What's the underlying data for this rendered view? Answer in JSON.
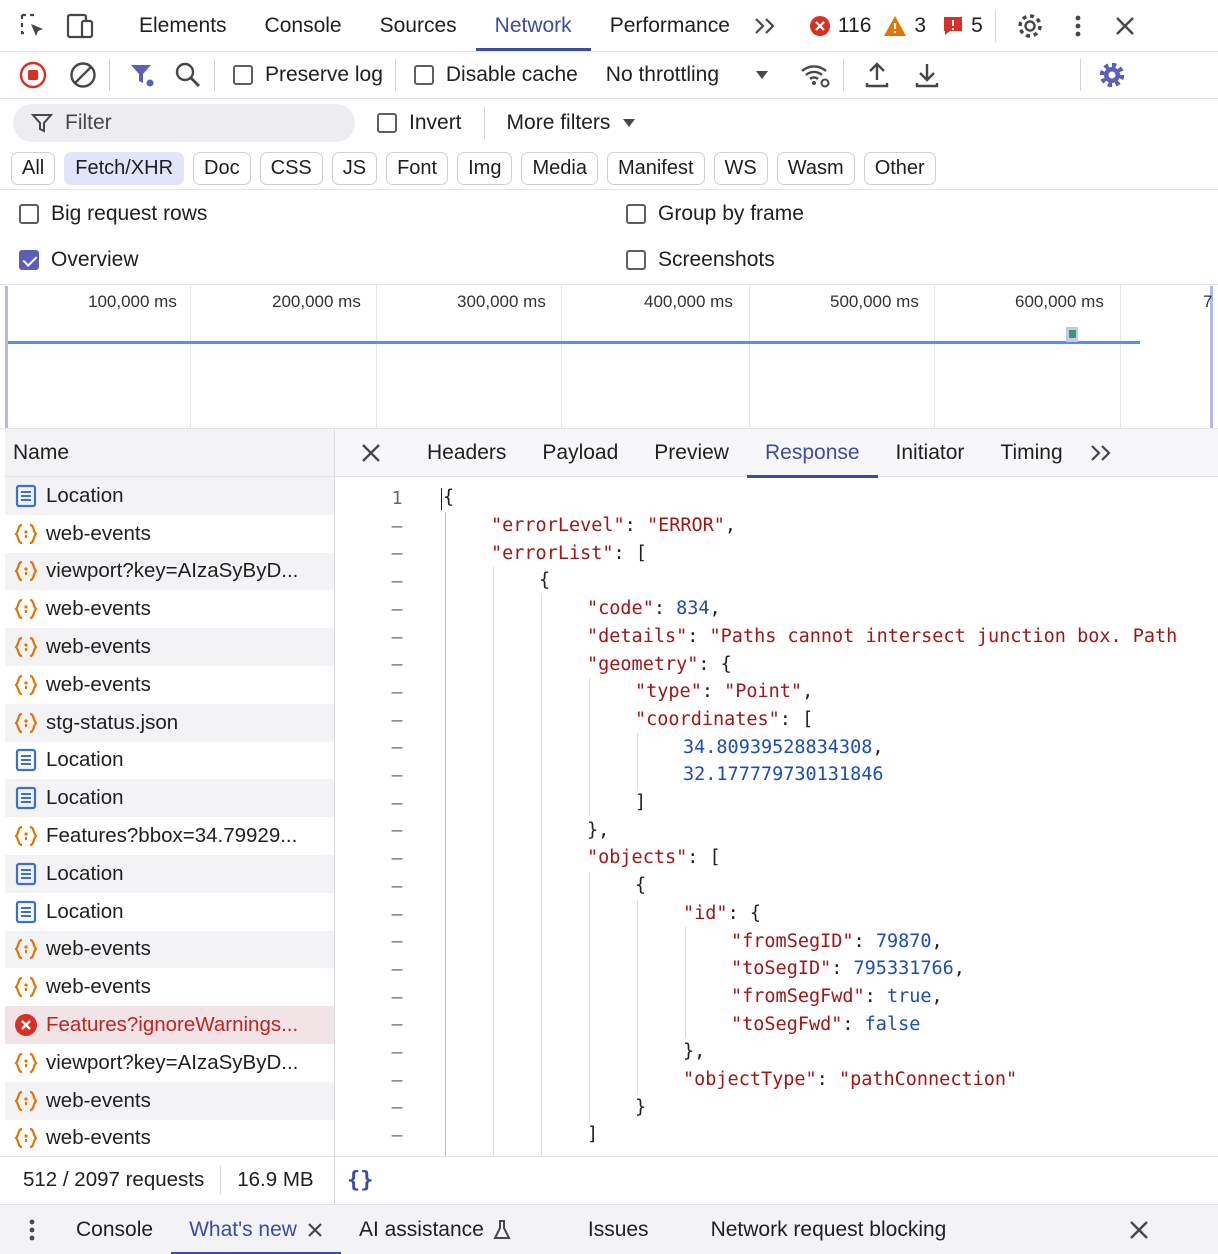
{
  "devtools": {
    "tabs": [
      "Elements",
      "Console",
      "Sources",
      "Network",
      "Performance"
    ],
    "active_tab": "Network",
    "error_count": "116",
    "warning_count": "3",
    "issue_count": "5"
  },
  "toolbar": {
    "preserve_log": "Preserve log",
    "disable_cache": "Disable cache",
    "throttling": "No throttling"
  },
  "filter_bar": {
    "placeholder": "Filter",
    "invert": "Invert",
    "more_filters": "More filters"
  },
  "type_filters": [
    "All",
    "Fetch/XHR",
    "Doc",
    "CSS",
    "JS",
    "Font",
    "Img",
    "Media",
    "Manifest",
    "WS",
    "Wasm",
    "Other"
  ],
  "active_type_filter": "Fetch/XHR",
  "options": {
    "big_request_rows": "Big request rows",
    "group_by_frame": "Group by frame",
    "overview": "Overview",
    "screenshots": "Screenshots"
  },
  "timeline": {
    "labels": [
      "100,000 ms",
      "200,000 ms",
      "300,000 ms",
      "400,000 ms",
      "500,000 ms",
      "600,000 ms",
      "7"
    ]
  },
  "request_list": {
    "header": "Name",
    "rows": [
      {
        "name": "Location",
        "icon": "document-icon"
      },
      {
        "name": "web-events",
        "icon": "fetch-icon"
      },
      {
        "name": "viewport?key=AIzaSyByD...",
        "icon": "fetch-icon"
      },
      {
        "name": "web-events",
        "icon": "fetch-icon"
      },
      {
        "name": "web-events",
        "icon": "fetch-icon"
      },
      {
        "name": "web-events",
        "icon": "fetch-icon"
      },
      {
        "name": "stg-status.json",
        "icon": "fetch-icon"
      },
      {
        "name": "Location",
        "icon": "document-icon"
      },
      {
        "name": "Location",
        "icon": "document-icon"
      },
      {
        "name": "Features?bbox=34.79929...",
        "icon": "fetch-icon"
      },
      {
        "name": "Location",
        "icon": "document-icon"
      },
      {
        "name": "Location",
        "icon": "document-icon"
      },
      {
        "name": "web-events",
        "icon": "fetch-icon"
      },
      {
        "name": "web-events",
        "icon": "fetch-icon"
      },
      {
        "name": "Features?ignoreWarnings...",
        "icon": "error-icon"
      },
      {
        "name": "viewport?key=AIzaSyByD...",
        "icon": "fetch-icon"
      },
      {
        "name": "web-events",
        "icon": "fetch-icon"
      },
      {
        "name": "web-events",
        "icon": "fetch-icon"
      }
    ],
    "summary_requests": "512 / 2097 requests",
    "summary_size": "16.9 MB"
  },
  "details": {
    "tabs": [
      "Headers",
      "Payload",
      "Preview",
      "Response",
      "Initiator",
      "Timing"
    ],
    "active_tab": "Response",
    "line_number": "1",
    "format_button": "{}"
  },
  "response_lines": [
    {
      "d": 0,
      "t": [
        [
          "p",
          "{"
        ]
      ]
    },
    {
      "d": 1,
      "t": [
        [
          "k",
          "\"errorLevel\""
        ],
        [
          "p",
          ": "
        ],
        [
          "s",
          "\"ERROR\""
        ],
        [
          "p",
          ","
        ]
      ]
    },
    {
      "d": 1,
      "t": [
        [
          "k",
          "\"errorList\""
        ],
        [
          "p",
          ": ["
        ]
      ]
    },
    {
      "d": 2,
      "t": [
        [
          "p",
          "{"
        ]
      ]
    },
    {
      "d": 3,
      "t": [
        [
          "k",
          "\"code\""
        ],
        [
          "p",
          ": "
        ],
        [
          "n",
          "834"
        ],
        [
          "p",
          ","
        ]
      ]
    },
    {
      "d": 3,
      "t": [
        [
          "k",
          "\"details\""
        ],
        [
          "p",
          ": "
        ],
        [
          "s",
          "\"Paths cannot intersect junction box. Path"
        ]
      ]
    },
    {
      "d": 3,
      "t": [
        [
          "k",
          "\"geometry\""
        ],
        [
          "p",
          ": {"
        ]
      ]
    },
    {
      "d": 4,
      "t": [
        [
          "k",
          "\"type\""
        ],
        [
          "p",
          ": "
        ],
        [
          "s",
          "\"Point\""
        ],
        [
          "p",
          ","
        ]
      ]
    },
    {
      "d": 4,
      "t": [
        [
          "k",
          "\"coordinates\""
        ],
        [
          "p",
          ": ["
        ]
      ]
    },
    {
      "d": 5,
      "t": [
        [
          "n",
          "34.80939528834308"
        ],
        [
          "p",
          ","
        ]
      ]
    },
    {
      "d": 5,
      "t": [
        [
          "n",
          "32.177779730131846"
        ]
      ]
    },
    {
      "d": 4,
      "t": [
        [
          "p",
          "]"
        ]
      ]
    },
    {
      "d": 3,
      "t": [
        [
          "p",
          "},"
        ]
      ]
    },
    {
      "d": 3,
      "t": [
        [
          "k",
          "\"objects\""
        ],
        [
          "p",
          ": ["
        ]
      ]
    },
    {
      "d": 4,
      "t": [
        [
          "p",
          "{"
        ]
      ]
    },
    {
      "d": 5,
      "t": [
        [
          "k",
          "\"id\""
        ],
        [
          "p",
          ": {"
        ]
      ]
    },
    {
      "d": 6,
      "t": [
        [
          "k",
          "\"fromSegID\""
        ],
        [
          "p",
          ": "
        ],
        [
          "n",
          "79870"
        ],
        [
          "p",
          ","
        ]
      ]
    },
    {
      "d": 6,
      "t": [
        [
          "k",
          "\"toSegID\""
        ],
        [
          "p",
          ": "
        ],
        [
          "n",
          "795331766"
        ],
        [
          "p",
          ","
        ]
      ]
    },
    {
      "d": 6,
      "t": [
        [
          "k",
          "\"fromSegFwd\""
        ],
        [
          "p",
          ": "
        ],
        [
          "b",
          "true"
        ],
        [
          "p",
          ","
        ]
      ]
    },
    {
      "d": 6,
      "t": [
        [
          "k",
          "\"toSegFwd\""
        ],
        [
          "p",
          ": "
        ],
        [
          "b",
          "false"
        ]
      ]
    },
    {
      "d": 5,
      "t": [
        [
          "p",
          "},"
        ]
      ]
    },
    {
      "d": 5,
      "t": [
        [
          "k",
          "\"objectType\""
        ],
        [
          "p",
          ": "
        ],
        [
          "s",
          "\"pathConnection\""
        ]
      ]
    },
    {
      "d": 4,
      "t": [
        [
          "p",
          "}"
        ]
      ]
    },
    {
      "d": 3,
      "t": [
        [
          "p",
          "]"
        ]
      ]
    }
  ],
  "drawer": {
    "tabs": [
      "Console",
      "What's new",
      "AI assistance",
      "Issues",
      "Network request blocking"
    ],
    "active_tab": "What's new"
  },
  "colors": {
    "accent": "#3b4ba6",
    "error": "#c5221f",
    "warning": "#e37400"
  }
}
